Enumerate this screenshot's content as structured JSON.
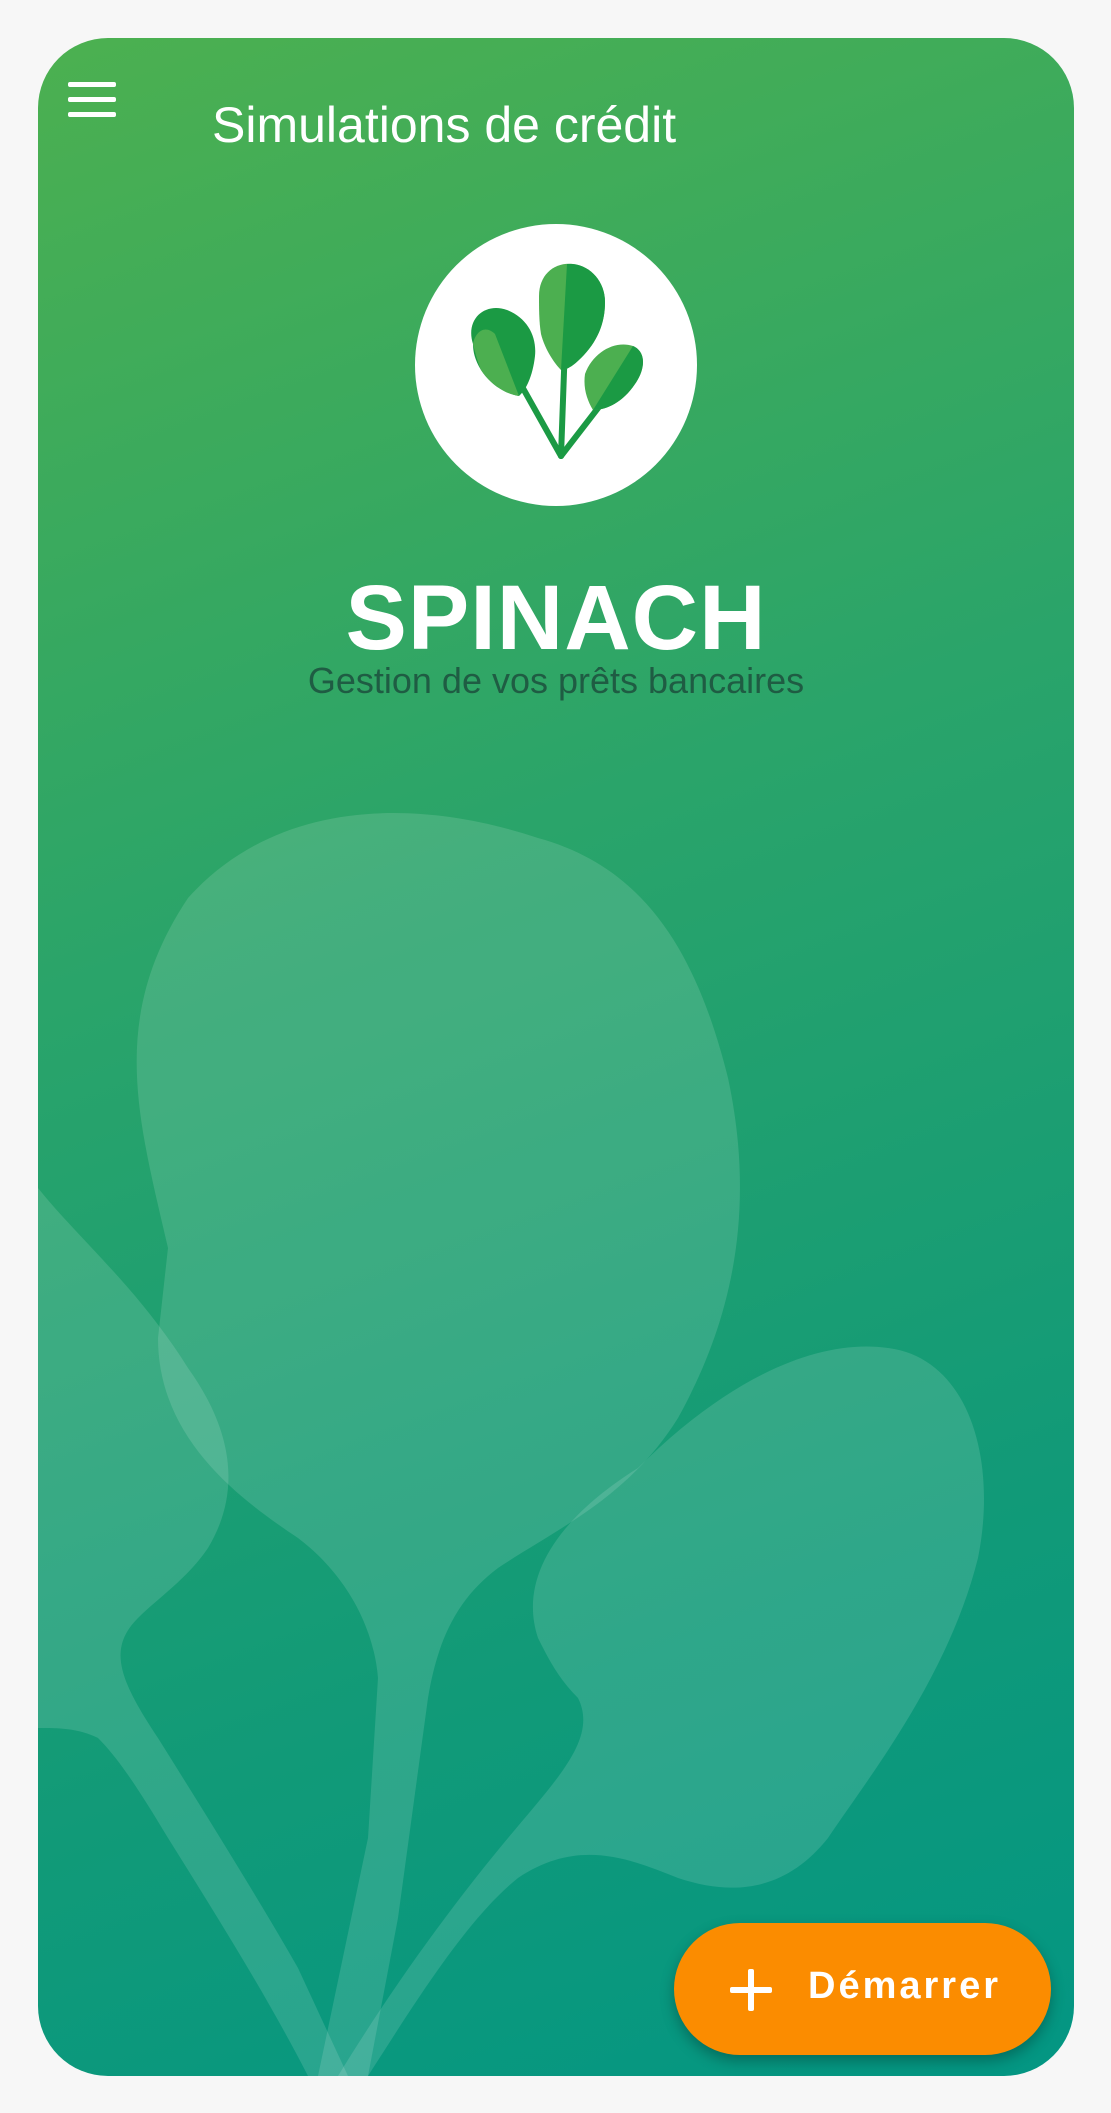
{
  "app_bar": {
    "title": "Simulations de crédit",
    "menu_icon": "hamburger-menu-icon"
  },
  "hero": {
    "logo_icon": "spinach-leaves-icon",
    "brand_name": "SPINACH",
    "tagline": "Gestion de vos prêts bancaires"
  },
  "fab": {
    "label": "Démarrer",
    "icon": "plus-icon"
  },
  "colors": {
    "gradient_top": "#4cb050",
    "gradient_bottom": "#039683",
    "fab_background": "#fb8c00",
    "text_primary": "#ffffff",
    "tagline_text": "#1f5c43",
    "logo_leaf_dark": "#1b9a44",
    "logo_leaf_light": "#4caf50"
  }
}
